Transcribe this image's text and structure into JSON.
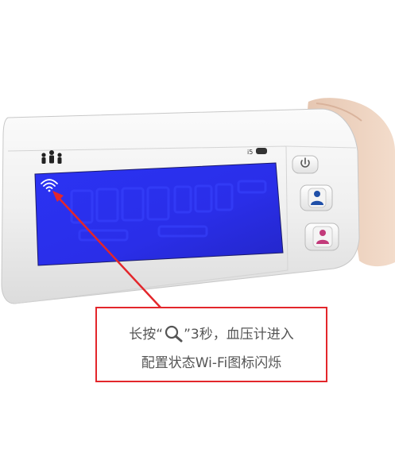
{
  "device": {
    "model_label": "i5",
    "wifi_badge": "Wi-Fi",
    "icons": [
      "people-logo-icon",
      "wifi-icon",
      "power-icon",
      "user-1-icon",
      "user-2-icon",
      "magnifier-icon"
    ],
    "colors": {
      "lcd_blue": "#2a2ff0",
      "callout_border": "#e3262b",
      "arrow": "#e3262b",
      "user1_button": "#1f4fa8",
      "user2_button": "#c23a7a"
    }
  },
  "callout": {
    "line1_prefix": "长按“",
    "line1_suffix": "”3秒，血压计进入",
    "line2": "配置状态Wi-Fi图标闪烁"
  }
}
